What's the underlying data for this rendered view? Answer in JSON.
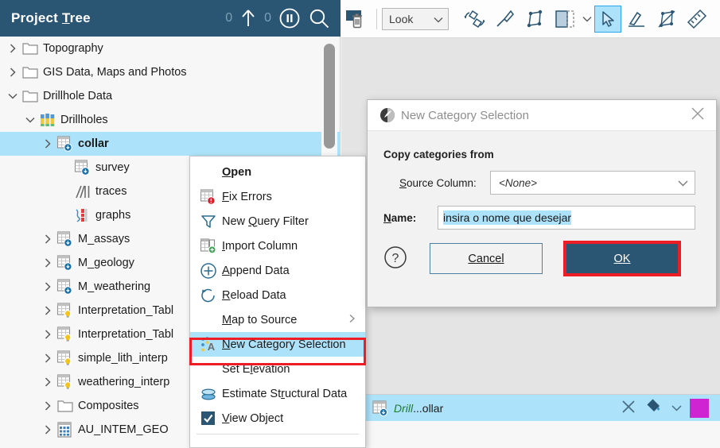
{
  "tree_panel": {
    "header": {
      "title_pre": "Project ",
      "title_accel": "T",
      "title_post": "ree",
      "count_left": "0",
      "count_right": "0",
      "upload_icon": "upload-arrow-icon",
      "pause_icon": "pause-circle-icon",
      "search_icon": "search-icon"
    },
    "items": [
      {
        "label": "Topography",
        "icon": "folder-icon",
        "indent": 1,
        "chevron": "right",
        "selected": false
      },
      {
        "label": "GIS Data, Maps and Photos",
        "icon": "folder-icon",
        "indent": 1,
        "chevron": "right",
        "selected": false
      },
      {
        "label": "Drillhole Data",
        "icon": "folder-icon",
        "indent": 1,
        "chevron": "down",
        "selected": false
      },
      {
        "label": "Drillholes",
        "icon": "drillholes-icon",
        "indent": 2,
        "chevron": "down",
        "selected": false
      },
      {
        "label": "collar",
        "icon": "table-data-icon",
        "indent": 3,
        "chevron": "right",
        "selected": true
      },
      {
        "label": "survey",
        "icon": "table-data-icon",
        "indent": 4,
        "chevron": "none",
        "selected": false
      },
      {
        "label": "traces",
        "icon": "traces-icon",
        "indent": 4,
        "chevron": "none",
        "selected": false
      },
      {
        "label": "graphs",
        "icon": "graphs-icon",
        "indent": 4,
        "chevron": "none",
        "selected": false
      },
      {
        "label": "M_assays",
        "icon": "table-data-icon",
        "indent": 3,
        "chevron": "right",
        "selected": false
      },
      {
        "label": "M_geology",
        "icon": "table-data-icon",
        "indent": 3,
        "chevron": "right",
        "selected": false
      },
      {
        "label": "M_weathering",
        "icon": "table-data-icon",
        "indent": 3,
        "chevron": "right",
        "selected": false
      },
      {
        "label": "Interpretation_Tabl",
        "icon": "table-interp-icon",
        "indent": 3,
        "chevron": "right",
        "selected": false
      },
      {
        "label": "Interpretation_Tabl",
        "icon": "table-interp-icon",
        "indent": 3,
        "chevron": "right",
        "selected": false
      },
      {
        "label": "simple_lith_interp",
        "icon": "table-interp-icon",
        "indent": 3,
        "chevron": "right",
        "selected": false
      },
      {
        "label": "weathering_interp",
        "icon": "table-interp-icon",
        "indent": 3,
        "chevron": "right",
        "selected": false
      },
      {
        "label": "Composites",
        "icon": "folder-icon",
        "indent": 3,
        "chevron": "right",
        "selected": false
      },
      {
        "label": "AU_INTEM_GEO",
        "icon": "block-model-icon",
        "indent": 3,
        "chevron": "right",
        "selected": false
      }
    ]
  },
  "toolbar": {
    "delete_label": "delete-scene-icon",
    "look_label": "Look",
    "buttons": [
      {
        "name": "delete-scene-button",
        "icon": "screen-trash-icon"
      },
      {
        "name": "orbit-button",
        "icon": "orbit-rotate-icon"
      },
      {
        "name": "draw-line-button",
        "icon": "pen-line-icon"
      },
      {
        "name": "draw-polygon-button",
        "icon": "polygon-node-icon"
      },
      {
        "name": "clipping-box-button",
        "icon": "clipping-box-icon"
      },
      {
        "name": "select-pointer-button",
        "icon": "arrow-pointer-icon"
      },
      {
        "name": "draw-slice-button",
        "icon": "pen-plane-icon"
      },
      {
        "name": "edit-polyline-button",
        "icon": "polyline-edit-icon"
      },
      {
        "name": "measure-button",
        "icon": "ruler-icon"
      }
    ]
  },
  "shape_list": {
    "row": {
      "visibility_icon": "eye-icon",
      "object_icon": "table-data-icon",
      "name_italic": "Drill",
      "name_rest": "...ollar",
      "remove_icon": "close-x-icon",
      "fill_icon": "paint-bucket-icon",
      "dropdown_icon": "chevron-down-icon",
      "color": "#cf24d2"
    }
  },
  "context_menu": {
    "items": [
      {
        "label": "Open",
        "accel": "O",
        "icon": "none",
        "bold": true,
        "submenu": false,
        "highlighted": false,
        "check": false
      },
      {
        "label": "Fix Errors",
        "accel": "F",
        "icon": "table-error-icon",
        "bold": false,
        "submenu": false,
        "highlighted": false,
        "check": false
      },
      {
        "label": "New Query Filter",
        "accel": "Q",
        "icon": "funnel-filter-icon",
        "bold": false,
        "submenu": false,
        "highlighted": false,
        "check": false
      },
      {
        "label": "Import Column",
        "accel": "I",
        "icon": "import-column-icon",
        "bold": false,
        "submenu": false,
        "highlighted": false,
        "check": false
      },
      {
        "label": "Append Data",
        "accel": "A",
        "icon": "plus-circle-icon",
        "bold": false,
        "submenu": false,
        "highlighted": false,
        "check": false
      },
      {
        "label": "Reload Data",
        "accel": "R",
        "icon": "reload-circle-icon",
        "bold": false,
        "submenu": false,
        "highlighted": false,
        "check": false
      },
      {
        "label": "Map to Source",
        "accel": "M",
        "icon": "none",
        "bold": false,
        "submenu": true,
        "highlighted": false,
        "check": false
      },
      {
        "label": "New Category Selection",
        "accel": "N",
        "icon": "category-select-icon",
        "bold": false,
        "submenu": false,
        "highlighted": true,
        "check": false
      },
      {
        "label": "Set Elevation",
        "accel": "l",
        "icon": "none",
        "bold": false,
        "submenu": false,
        "highlighted": false,
        "check": false
      },
      {
        "label": "Estimate Structural Data",
        "accel": "r",
        "icon": "structural-disc-icon",
        "bold": false,
        "submenu": false,
        "highlighted": false,
        "check": false
      },
      {
        "label": "View Object",
        "accel": "V",
        "icon": "checkbox-checked-icon",
        "bold": false,
        "submenu": false,
        "highlighted": false,
        "check": true
      }
    ],
    "highlight_color": "#ee1c25"
  },
  "dialog": {
    "title": "New Category Selection",
    "title_icon": "app-logo-icon",
    "close_icon": "close-x-icon",
    "section_label": "Copy categories from",
    "source_column": {
      "label_pre": "S",
      "label_post": "ource Column:",
      "value": "<None>",
      "dropdown_icon": "chevron-down-icon"
    },
    "name_field": {
      "label_pre": "N",
      "label_post": "ame:",
      "value": "insira o nome que desejar",
      "selected": true
    },
    "help_icon": "question-circle-icon",
    "cancel_label_pre": "C",
    "cancel_label_post": "ancel",
    "ok_label_pre": "O",
    "ok_label_post": "K",
    "ok_highlight_color": "#ee1c25",
    "ok_bg": "#2a5674"
  }
}
